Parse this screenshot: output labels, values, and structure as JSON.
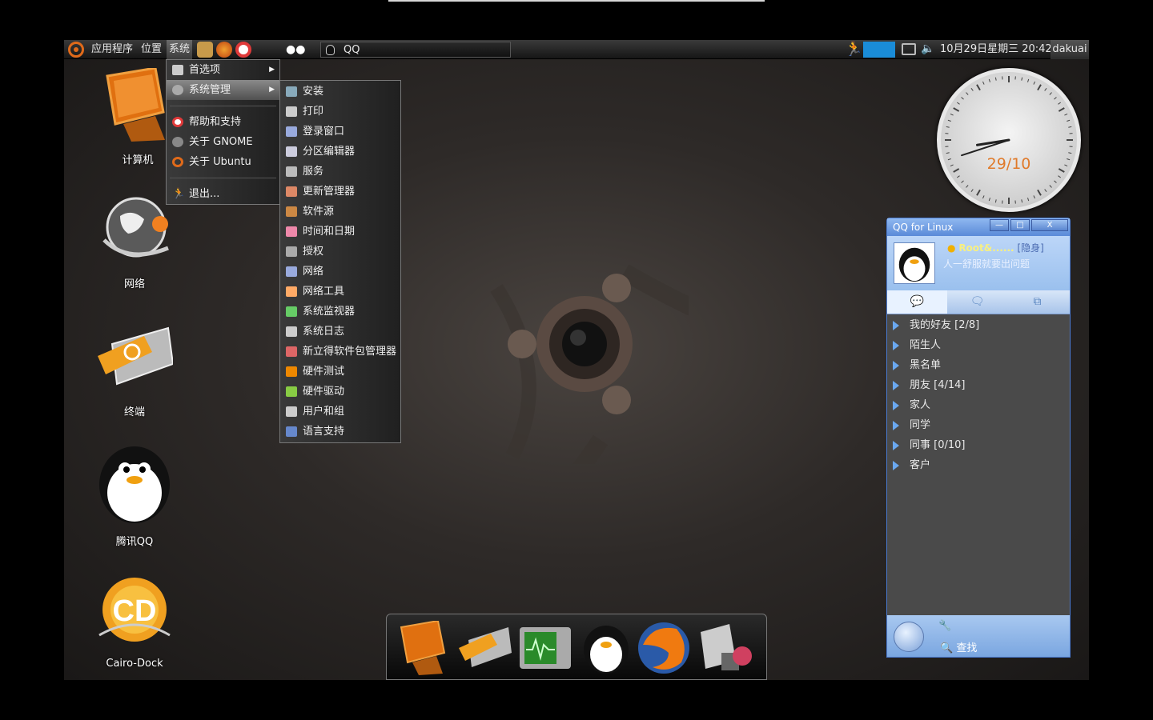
{
  "panel": {
    "menu_applications": "应用程序",
    "menu_places": "位置",
    "menu_system": "系统",
    "task_qq": "QQ",
    "clock": "10月29日星期三 20:42",
    "user": "dakuai"
  },
  "system_menu": {
    "items": [
      "首选项",
      "系统管理",
      "帮助和支持",
      "关于 GNOME",
      "关于 Ubuntu",
      "退出..."
    ]
  },
  "admin_menu": {
    "items": [
      "安装",
      "打印",
      "登录窗口",
      "分区编辑器",
      "服务",
      "更新管理器",
      "软件源",
      "时间和日期",
      "授权",
      "网络",
      "网络工具",
      "系统监视器",
      "系统日志",
      "新立得软件包管理器",
      "硬件测试",
      "硬件驱动",
      "用户和组",
      "语言支持"
    ]
  },
  "desktop_icons": [
    "计算机",
    "网络",
    "终端",
    "腾讯QQ",
    "Cairo-Dock"
  ],
  "clock_widget": {
    "date": "29/10",
    "hour": 20,
    "minute": 42
  },
  "qq": {
    "title": "QQ for Linux",
    "btn_min": "—",
    "btn_max": "□",
    "btn_close": "X",
    "name": "Root&......",
    "status": "[隐身]",
    "signature": "人一舒服就要出问题",
    "groups": [
      "我的好友 [2/8]",
      "陌生人",
      "黑名单",
      "朋友 [4/14]",
      "家人",
      "同学",
      "同事 [0/10]",
      "客户"
    ],
    "search": "查找"
  },
  "icons": {
    "tab_chat": "speech-bubble-icon",
    "tab_groups": "group-chat-icon",
    "tab_recent": "recent-icon"
  }
}
